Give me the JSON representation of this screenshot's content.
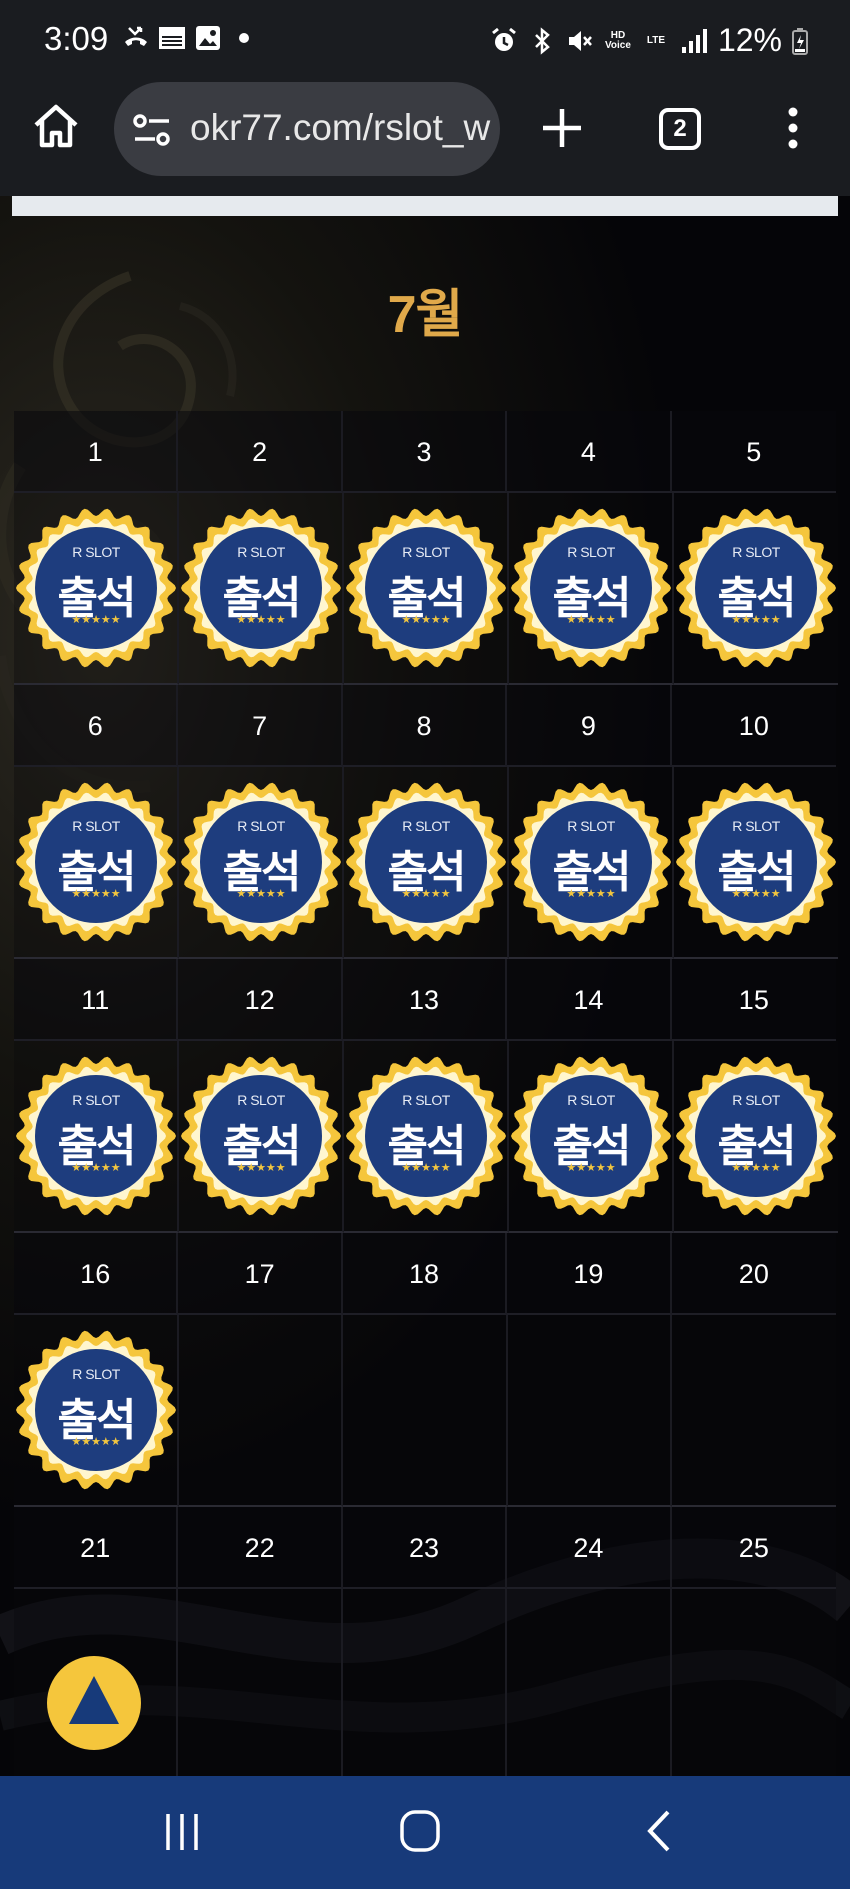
{
  "status_bar": {
    "time": "3:09",
    "news_icon_text": "NEWS",
    "hd_voice_text": "HD Voice",
    "lte_text": "LTE",
    "battery": "12%",
    "left_icons": [
      "missed-call-icon",
      "news-icon",
      "gallery-icon",
      "dot-icon"
    ],
    "right_icons": [
      "alarm-icon",
      "bluetooth-icon",
      "mute-icon",
      "hd-voice-icon",
      "lte-icon",
      "signal-icon",
      "battery-icon"
    ]
  },
  "browser": {
    "url": "okr77.com/rslot_w",
    "tab_count": "2"
  },
  "page": {
    "month_title": "7월",
    "badge": {
      "brand": "R SLOT",
      "label": "출석",
      "stars": "★★★★★",
      "gold": "#f5c63c",
      "blue": "#1e3d7e"
    },
    "weeks": [
      {
        "days": [
          "1",
          "2",
          "3",
          "4",
          "5"
        ],
        "attended": [
          true,
          true,
          true,
          true,
          true
        ]
      },
      {
        "days": [
          "6",
          "7",
          "8",
          "9",
          "10"
        ],
        "attended": [
          true,
          true,
          true,
          true,
          true
        ]
      },
      {
        "days": [
          "11",
          "12",
          "13",
          "14",
          "15"
        ],
        "attended": [
          true,
          true,
          true,
          true,
          true
        ]
      },
      {
        "days": [
          "16",
          "17",
          "18",
          "19",
          "20"
        ],
        "attended": [
          true,
          false,
          false,
          false,
          false
        ]
      },
      {
        "days": [
          "21",
          "22",
          "23",
          "24",
          "25"
        ],
        "attended": [
          false,
          false,
          false,
          false,
          false
        ]
      }
    ]
  },
  "colors": {
    "month_title": "#e0a94a",
    "nav_bar": "#173a7a",
    "scroll_top": "#f5c63c"
  }
}
